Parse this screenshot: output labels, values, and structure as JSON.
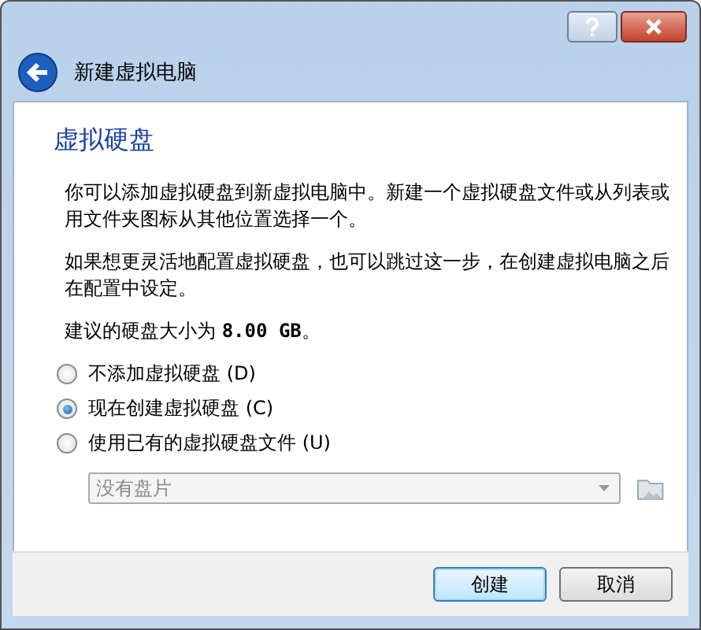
{
  "window": {
    "title": "新建虚拟电脑"
  },
  "page": {
    "heading": "虚拟硬盘",
    "paragraphs": [
      "你可以添加虚拟硬盘到新虚拟电脑中。新建一个虚拟硬盘文件或从列表或用文件夹图标从其他位置选择一个。",
      "如果想更灵活地配置虚拟硬盘，也可以跳过这一步，在创建虚拟电脑之后在配置中设定。"
    ],
    "size_note": "建议的硬盘大小为 **8.00 GB**。"
  },
  "options": [
    {
      "label": "不添加虚拟硬盘 (D)",
      "selected": false
    },
    {
      "label": "现在创建虚拟硬盘 (C)",
      "selected": true
    },
    {
      "label": "使用已有的虚拟硬盘文件 (U)",
      "selected": false
    }
  ],
  "disk_combo": {
    "value": "没有盘片",
    "disabled": true
  },
  "buttons": [
    {
      "label": "创建",
      "default": true
    },
    {
      "label": "取消",
      "default": false
    }
  ]
}
